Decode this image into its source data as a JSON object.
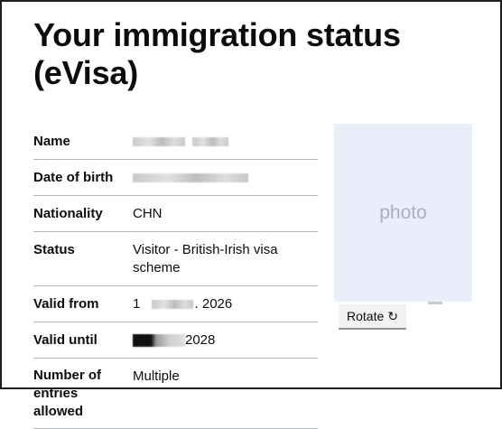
{
  "page": {
    "title": "Your immigration status (eVisa)"
  },
  "details": {
    "name": {
      "label": "Name",
      "value": ""
    },
    "date_of_birth": {
      "label": "Date of birth",
      "value": ""
    },
    "nationality": {
      "label": "Nationality",
      "value": "CHN"
    },
    "status": {
      "label": "Status",
      "value": "Visitor - British-Irish visa scheme"
    },
    "valid_from": {
      "label": "Valid from",
      "prefix": "1",
      "suffix": ". 2026"
    },
    "valid_until": {
      "label": "Valid until",
      "suffix": "2028"
    },
    "entries": {
      "label_lines": [
        "Number of",
        "entries",
        "allowed"
      ],
      "value": "Multiple"
    }
  },
  "photo": {
    "placeholder": "photo"
  },
  "rotate_button": {
    "label": "Rotate",
    "icon": "rotate-clockwise-icon",
    "glyph": "↻"
  },
  "colors": {
    "photo_bg": "#e9eefa",
    "button_bg": "#f3f2f1",
    "divider": "#b1b4b6"
  }
}
